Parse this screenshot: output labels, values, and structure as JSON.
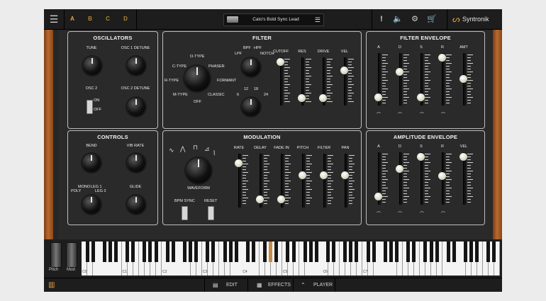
{
  "topbar": {
    "slots": [
      "A",
      "B",
      "C",
      "D"
    ],
    "preset_name": "Cato's Bold Sync Lead",
    "brand": "Syntronik",
    "icons": [
      "menu-icon",
      "list-icon",
      "alert-icon",
      "speaker-icon",
      "gear-icon",
      "cart-icon",
      "syntronik-logo-icon"
    ]
  },
  "oscillators": {
    "title": "OSCILLATORS",
    "tune": "TUNE",
    "osc1_detune": "OSC 1 DETUNE",
    "osc2": "OSC 2",
    "osc2_detune": "OSC 2 DETUNE",
    "on": "ON",
    "off": "OFF"
  },
  "filter": {
    "title": "FILTER",
    "types": [
      "O-TYPE",
      "C-TYPE",
      "PHASER",
      "R-TYPE",
      "FORMANT",
      "M-TYPE",
      "CLASSIC",
      "OFF"
    ],
    "modes": [
      "LPF",
      "BPF",
      "HPF",
      "NOTCH"
    ],
    "slopes": [
      "6",
      "12",
      "18",
      "24"
    ],
    "faders": [
      {
        "label": "CUTOFF",
        "value": 0.95
      },
      {
        "label": "RES",
        "value": 0.1
      },
      {
        "label": "DRIVE",
        "value": 0.1
      },
      {
        "label": "VEL",
        "value": 0.75
      }
    ]
  },
  "filter_envelope": {
    "title": "FILTER ENVELOPE",
    "faders": [
      {
        "label": "A",
        "value": 0.1
      },
      {
        "label": "D",
        "value": 0.65
      },
      {
        "label": "S",
        "value": 0.1
      },
      {
        "label": "R",
        "value": 0.95
      },
      {
        "label": "AMT",
        "value": 0.5
      }
    ]
  },
  "controls": {
    "title": "CONTROLS",
    "bend": "BEND",
    "vib_rate": "VIB RATE",
    "glide": "GLIDE",
    "mono": "MONO",
    "leg1": "LEG 1",
    "poly": "POLY",
    "leg2": "LEG 2"
  },
  "modulation": {
    "title": "MODULATION",
    "waveform": "WAVEFORM",
    "bpm_sync": "BPM SYNC",
    "reset": "RESET",
    "faders": [
      {
        "label": "RATE",
        "value": 0.85
      },
      {
        "label": "DELAY",
        "value": 0.1
      },
      {
        "label": "FADE IN",
        "value": 0.1
      },
      {
        "label": "PITCH",
        "value": 0.6
      },
      {
        "label": "FILTER",
        "value": 0.6
      },
      {
        "label": "PAN",
        "value": 0.6
      }
    ]
  },
  "amplitude_envelope": {
    "title": "AMPLITUDE ENVELOPE",
    "faders": [
      {
        "label": "A",
        "value": 0.1
      },
      {
        "label": "D",
        "value": 0.7
      },
      {
        "label": "S",
        "value": 0.95
      },
      {
        "label": "R",
        "value": 0.55
      },
      {
        "label": "VEL",
        "value": 0.95
      }
    ]
  },
  "keyboard": {
    "pitch": "Pitch",
    "mod": "Mod",
    "octaves": [
      "C0",
      "C1",
      "C2",
      "C3",
      "C4",
      "C5",
      "C6",
      "C7"
    ],
    "highlighted_black_key_index": 23
  },
  "bottombar": {
    "edit": "EDIT",
    "effects": "EFFECTS",
    "player": "PLAYER"
  }
}
